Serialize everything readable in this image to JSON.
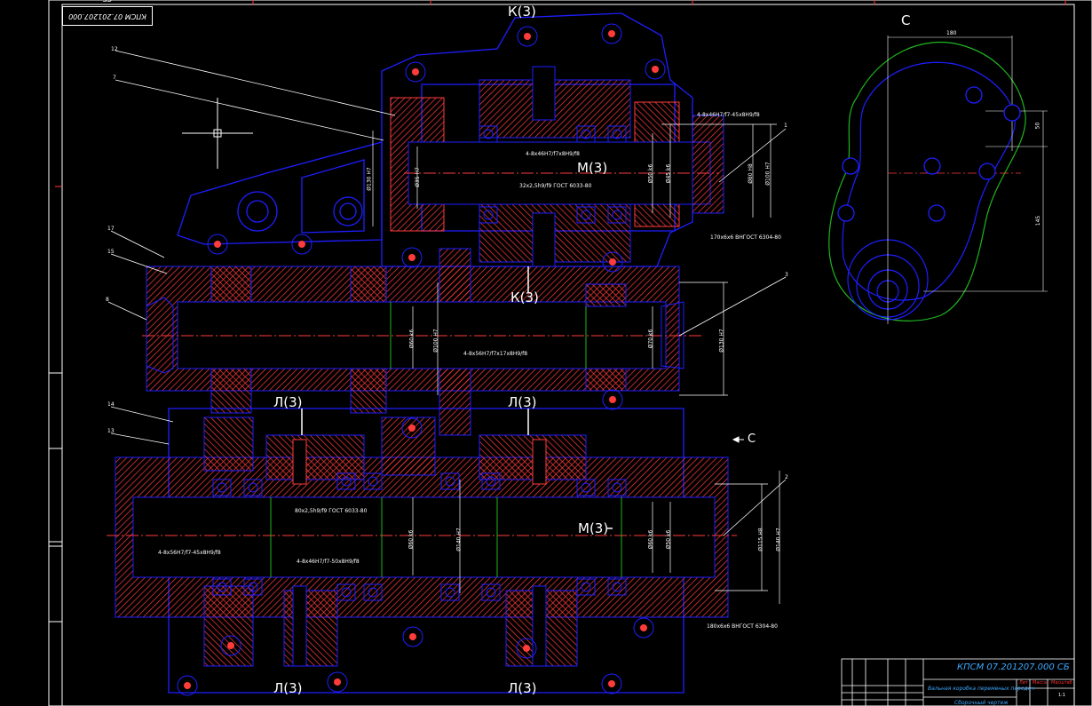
{
  "drawing": {
    "stamp_code": "КПСМ 07.201207.000 СБ",
    "view_letter": "С",
    "arrow_label": "С",
    "section_labels": {
      "k_top": "К(3)",
      "k_mid": "К(3)",
      "m_upper": "М(3)",
      "m_lower": "М(3)",
      "l_left": "Л(3)",
      "l_right": "Л(3)",
      "l_bottom_left": "Л(3)",
      "l_bottom_right": "Л(3)"
    },
    "positions": [
      "12",
      "7",
      "17",
      "15",
      "8",
      "14",
      "13",
      "1",
      "3",
      "2"
    ],
    "dimensions": {
      "d_180": "180",
      "d_50": "50",
      "d_145": "145",
      "upper_spline": "4-8x46H7/f7-45x8H9/f8",
      "upper_spline_mid": "4-8x46H7/f7x8H9/f8",
      "upper_gear_note": "32x2,5h9/f9 ГОСТ 6033-80",
      "upper_right_note": "170x6x6 ВНГОСТ 6304-80",
      "mid_spline": "4-8x56H7/f7x17x8H9/f8",
      "lower_note_left": "80x2,5h9/f9 ГОСТ 6033-80",
      "lower_spline_left": "4-8x56H7/f7-45x8H9/f8",
      "lower_spline_mid": "4-8x46H7/f7-50x8H9/f8",
      "lower_right_note": "180x6x6 ВНГОСТ 6304-80",
      "d_vert_upper_left": "Ø130 H7",
      "d_vert_upper_mid": "Ø35 H7",
      "d_vert_upper_right1": "Ø50 k6",
      "d_vert_upper_right2": "Ø45 k6",
      "d_vert_upper_right3": "Ø80 H8",
      "d_vert_upper_right4": "Ø100 H7",
      "d_vert_mid_left1": "Ø60 k6",
      "d_vert_mid_left2": "Ø100 H7",
      "d_vert_mid_right1": "Ø70 k6",
      "d_vert_mid_right2": "Ø130 H7",
      "d_vert_low_mid1": "Ø60 k6",
      "d_vert_low_mid2": "Ø140 H7",
      "d_vert_low_right1": "Ø60 k6",
      "d_vert_low_right2": "Ø50 k6",
      "d_vert_low_right3": "Ø115 H8",
      "d_vert_low_right4": "Ø140 H7"
    },
    "title_block": {
      "code": "КПСМ 07.201207.000 СБ",
      "name": "Вальная коробка переменых передач",
      "name2": "Сборочный чертеж",
      "lit": "Лит",
      "mass": "Масса",
      "scale": "Масштаб",
      "scale_value": "1:1"
    },
    "colors": {
      "frame": "#ffffff",
      "outline": "#1e1eff",
      "hatch": "#ff3b3b",
      "center": "#ff3b3b",
      "green": "#1fb51f",
      "accent": "#3fa9ff"
    }
  }
}
